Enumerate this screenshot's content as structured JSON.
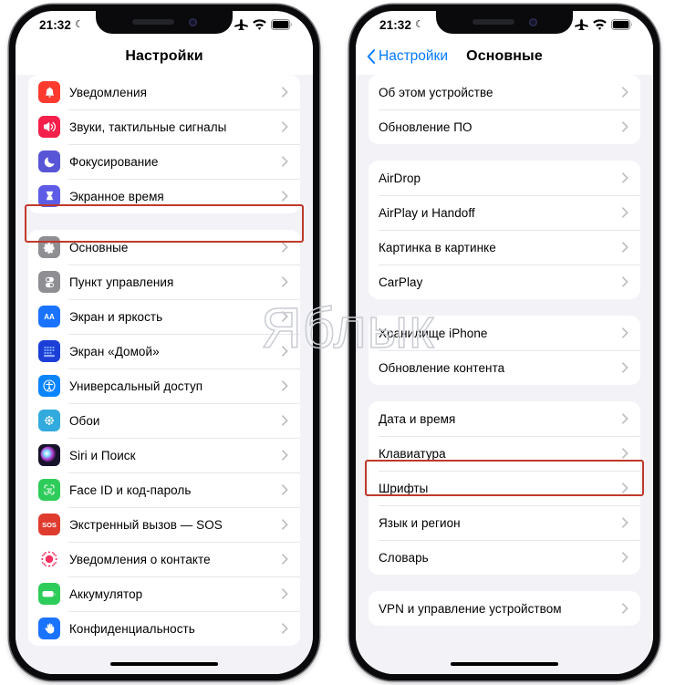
{
  "status_bar": {
    "time": "21:32",
    "moon_glyph": "☾",
    "icons": [
      "airplane-mode-icon",
      "wifi-icon",
      "battery-icon"
    ]
  },
  "left_phone": {
    "nav": {
      "title": "Настройки"
    },
    "highlight_color": "#c0392b",
    "highlighted_row": "Основные",
    "groups": [
      {
        "rows": [
          {
            "label": "Уведомления",
            "icon": "bell-icon",
            "color": "#ff3b30"
          },
          {
            "label": "Звуки, тактильные сигналы",
            "icon": "speaker-icon",
            "color": "#f4204b"
          },
          {
            "label": "Фокусирование",
            "icon": "moon-icon",
            "color": "#5856d6"
          },
          {
            "label": "Экранное время",
            "icon": "hourglass-icon",
            "color": "#5e5ce6"
          }
        ]
      },
      {
        "rows": [
          {
            "label": "Основные",
            "icon": "gear-icon",
            "color": "#8e8e93"
          },
          {
            "label": "Пункт управления",
            "icon": "control-center-icon",
            "color": "#8e8e93"
          },
          {
            "label": "Экран и яркость",
            "icon": "display-aa-icon",
            "color": "#1a73ff"
          },
          {
            "label": "Экран «Домой»",
            "icon": "home-screen-icon",
            "color": "#1b3fd6"
          },
          {
            "label": "Универсальный доступ",
            "icon": "accessibility-icon",
            "color": "#0a84ff"
          },
          {
            "label": "Обои",
            "icon": "wallpaper-icon",
            "color": "#33aadd"
          },
          {
            "label": "Siri и Поиск",
            "icon": "siri-icon",
            "color": "#18122a"
          },
          {
            "label": "Face ID и код-пароль",
            "icon": "face-id-icon",
            "color": "#2ecc5a"
          },
          {
            "label": "Экстренный вызов — SOS",
            "icon": "sos-icon",
            "color": "#e03b2f"
          },
          {
            "label": "Уведомления о контакте",
            "icon": "contact-alert-icon",
            "color": "#ffffff"
          },
          {
            "label": "Аккумулятор",
            "icon": "battery-green-icon",
            "color": "#2ecc5a"
          },
          {
            "label": "Конфиденциальность",
            "icon": "privacy-hand-icon",
            "color": "#1a73ff"
          }
        ]
      }
    ]
  },
  "right_phone": {
    "nav": {
      "back_label": "Настройки",
      "title": "Основные"
    },
    "highlight_color": "#c0392b",
    "highlighted_row": "Клавиатура",
    "groups": [
      {
        "rows": [
          {
            "label": "Об этом устройстве"
          },
          {
            "label": "Обновление ПО"
          }
        ]
      },
      {
        "rows": [
          {
            "label": "AirDrop"
          },
          {
            "label": "AirPlay и Handoff"
          },
          {
            "label": "Картинка в картинке"
          },
          {
            "label": "CarPlay"
          }
        ]
      },
      {
        "rows": [
          {
            "label": "Хранилище iPhone"
          },
          {
            "label": "Обновление контента"
          }
        ]
      },
      {
        "rows": [
          {
            "label": "Дата и время"
          },
          {
            "label": "Клавиатура"
          },
          {
            "label": "Шрифты"
          },
          {
            "label": "Язык и регион"
          },
          {
            "label": "Словарь"
          }
        ]
      },
      {
        "rows": [
          {
            "label": "VPN и управление устройством"
          }
        ]
      }
    ]
  },
  "watermark": {
    "text": "Яблык"
  }
}
